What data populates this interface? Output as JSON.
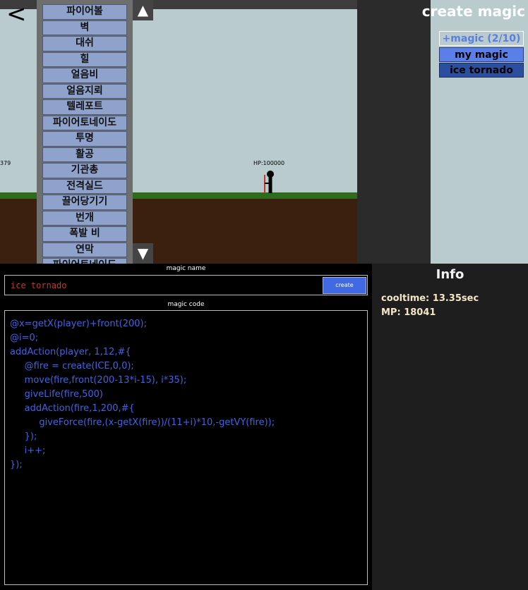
{
  "game": {
    "back_label": "<",
    "enemy_hp_partial": "379",
    "player_hp": "HP:100000",
    "scroll_up": "▲",
    "scroll_down": "▼",
    "spells": [
      "파이어볼",
      "벽",
      "대쉬",
      "힐",
      "얼음비",
      "얼음지뢰",
      "텔레포트",
      "파이어토네이도",
      "투명",
      "활공",
      "기관총",
      "전격실드",
      "끌어당기기",
      "번개",
      "폭발 비",
      "연막",
      "파이어토네이도"
    ]
  },
  "right_panel": {
    "title": "create magic",
    "add_slot": "+magic (2/10)",
    "slots": [
      "my magic",
      "ice tornado"
    ]
  },
  "editor": {
    "name_label": "magic name",
    "name_value": "ice tornado",
    "create_label": "create",
    "code_label": "magic code",
    "code_lines": [
      "@x=getX(player)+front(200);",
      "@i=0;",
      "addAction(player, 1,12,#{",
      "     @fire = create(ICE,0,0);",
      "     move(fire,front(200-13*i-15), i*35);",
      "     giveLife(fire,500)",
      "     addAction(fire,1,200,#{",
      "          giveForce(fire,(x-getX(fire))/(11+i)*10,-getVY(fire));",
      "     });",
      "     i++;",
      "});"
    ]
  },
  "info": {
    "title": "Info",
    "cooltime": "cooltime: 13.35sec",
    "mp": "MP: 18041"
  },
  "colors": {
    "code_text": "#3f63e6",
    "name_text": "#c0392b",
    "create_button": "#4169e1",
    "spell_button": "#8fa2cc",
    "selected_slot": "#2b4f9e"
  }
}
